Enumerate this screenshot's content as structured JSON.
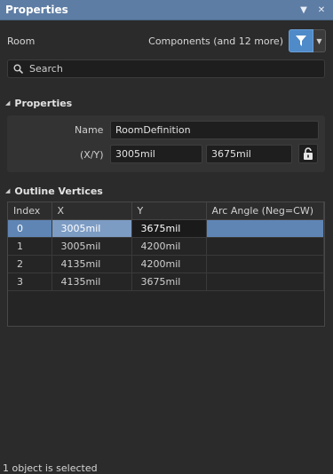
{
  "panel": {
    "title": "Properties",
    "menu_icon": "dropdown-triangle-icon",
    "close_icon": "close-icon"
  },
  "filter_row": {
    "object_type": "Room",
    "components_label": "Components (and 12 more)",
    "filter_icon": "filter-icon",
    "accent": "#4f8ac9"
  },
  "search": {
    "placeholder": "Search",
    "value": ""
  },
  "properties": {
    "header": "Properties",
    "name_label": "Name",
    "name_value": "RoomDefinition",
    "xy_label": "(X/Y)",
    "x_value": "3005mil",
    "y_value": "3675mil",
    "lock_icon": "unlocked-padlock-icon"
  },
  "outline": {
    "header": "Outline Vertices",
    "columns": [
      "Index",
      "X",
      "Y",
      "Arc Angle (Neg=CW)"
    ],
    "rows": [
      {
        "index": "0",
        "x": "3005mil",
        "y": "3675mil",
        "arc": ""
      },
      {
        "index": "1",
        "x": "3005mil",
        "y": "4200mil",
        "arc": ""
      },
      {
        "index": "2",
        "x": "4135mil",
        "y": "4200mil",
        "arc": ""
      },
      {
        "index": "3",
        "x": "4135mil",
        "y": "3675mil",
        "arc": ""
      }
    ],
    "selected_row": 0
  },
  "status": {
    "text": "1 object is selected"
  }
}
